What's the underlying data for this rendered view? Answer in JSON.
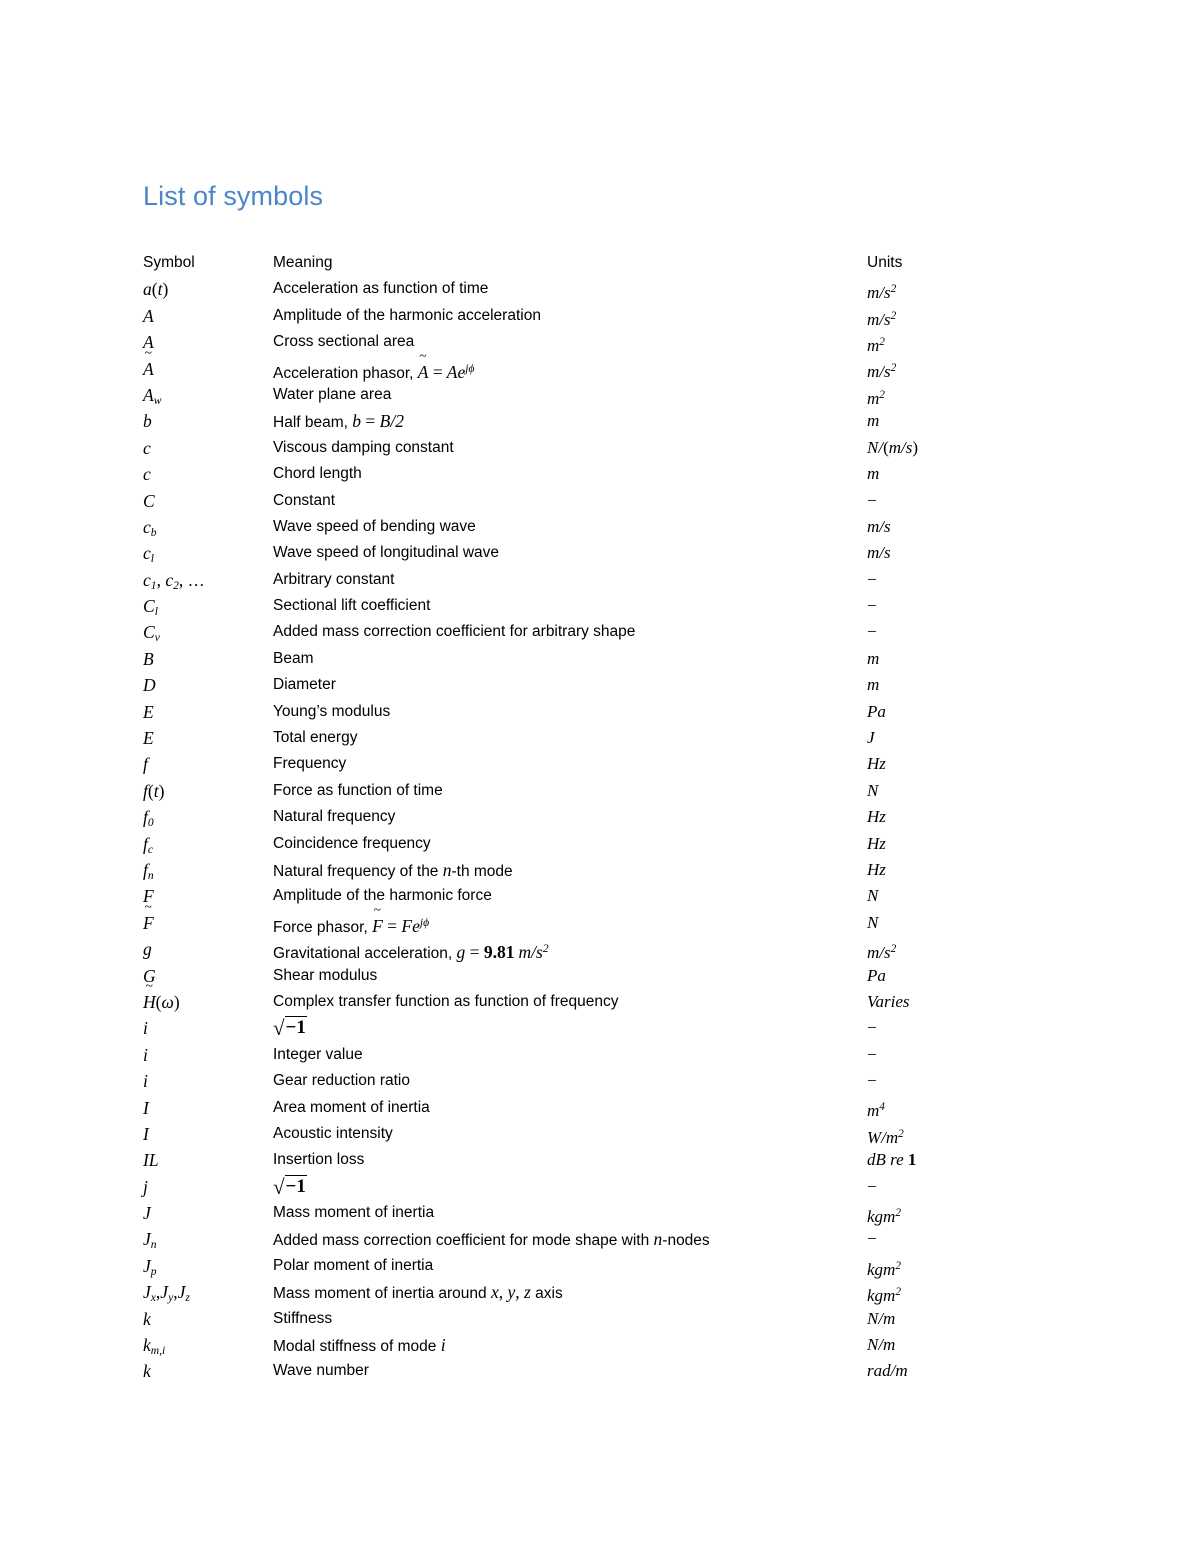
{
  "document": {
    "title": "List of symbols",
    "title_color": "#4a86c8"
  },
  "table": {
    "headers": {
      "symbol": "Symbol",
      "meaning": "Meaning",
      "units": "Units"
    },
    "rows": [
      {
        "symbol": "a(t)",
        "meaning": "Acceleration as function of time",
        "units": "m/s²"
      },
      {
        "symbol": "A",
        "meaning": "Amplitude of the harmonic acceleration",
        "units": "m/s²"
      },
      {
        "symbol": "A",
        "meaning": "Cross sectional area",
        "units": "m²"
      },
      {
        "symbol": "Ã",
        "meaning": "Acceleration phasor, Ã = Ae^{jφ}",
        "units": "m/s²"
      },
      {
        "symbol": "A_w",
        "meaning": "Water plane area",
        "units": "m²"
      },
      {
        "symbol": "b",
        "meaning": "Half beam, b = B/2",
        "units": "m"
      },
      {
        "symbol": "c",
        "meaning": "Viscous damping constant",
        "units": "N/(m/s)"
      },
      {
        "symbol": "c",
        "meaning": "Chord length",
        "units": "m"
      },
      {
        "symbol": "C",
        "meaning": "Constant",
        "units": "−"
      },
      {
        "symbol": "c_b",
        "meaning": "Wave speed of bending wave",
        "units": "m/s"
      },
      {
        "symbol": "c_l",
        "meaning": "Wave speed of longitudinal wave",
        "units": "m/s"
      },
      {
        "symbol": "c_1, c_2, …",
        "meaning": "Arbitrary constant",
        "units": "−"
      },
      {
        "symbol": "C_l",
        "meaning": "Sectional lift coefficient",
        "units": "−"
      },
      {
        "symbol": "C_v",
        "meaning": "Added mass correction coefficient for arbitrary shape",
        "units": "−"
      },
      {
        "symbol": "B",
        "meaning": "Beam",
        "units": "m"
      },
      {
        "symbol": "D",
        "meaning": "Diameter",
        "units": "m"
      },
      {
        "symbol": "E",
        "meaning": "Young’s modulus",
        "units": "Pa"
      },
      {
        "symbol": "E",
        "meaning": "Total energy",
        "units": "J"
      },
      {
        "symbol": "f",
        "meaning": "Frequency",
        "units": "Hz"
      },
      {
        "symbol": "f(t)",
        "meaning": "Force as function of time",
        "units": "N"
      },
      {
        "symbol": "f_0",
        "meaning": "Natural frequency",
        "units": "Hz"
      },
      {
        "symbol": "f_c",
        "meaning": "Coincidence frequency",
        "units": "Hz"
      },
      {
        "symbol": "f_n",
        "meaning": "Natural frequency of the n-th mode",
        "units": "Hz"
      },
      {
        "symbol": "F",
        "meaning": "Amplitude of the harmonic force",
        "units": "N"
      },
      {
        "symbol": "F̃",
        "meaning": "Force phasor, F̃ = Fe^{jφ}",
        "units": "N"
      },
      {
        "symbol": "g",
        "meaning": "Gravitational acceleration, g = 9.81 m/s²",
        "units": "m/s²"
      },
      {
        "symbol": "G",
        "meaning": "Shear modulus",
        "units": "Pa"
      },
      {
        "symbol": "H̃(ω)",
        "meaning": "Complex transfer function as function of frequency",
        "units": "Varies"
      },
      {
        "symbol": "i",
        "meaning": "√−1",
        "units": "−"
      },
      {
        "symbol": "i",
        "meaning": "Integer value",
        "units": "−"
      },
      {
        "symbol": "i",
        "meaning": "Gear reduction ratio",
        "units": "−"
      },
      {
        "symbol": "I",
        "meaning": "Area moment of inertia",
        "units": "m⁴"
      },
      {
        "symbol": "I",
        "meaning": "Acoustic intensity",
        "units": "W/m²"
      },
      {
        "symbol": "IL",
        "meaning": "Insertion loss",
        "units": "dB re 1"
      },
      {
        "symbol": "j",
        "meaning": "√−1",
        "units": "−"
      },
      {
        "symbol": "J",
        "meaning": "Mass moment of inertia",
        "units": "kgm²"
      },
      {
        "symbol": "J_n",
        "meaning": "Added mass correction coefficient for mode shape with n-nodes",
        "units": "−"
      },
      {
        "symbol": "J_p",
        "meaning": "Polar moment of inertia",
        "units": "kgm²"
      },
      {
        "symbol": "J_x, J_y, J_z",
        "meaning": "Mass moment of inertia around x, y, z axis",
        "units": "kgm²"
      },
      {
        "symbol": "k",
        "meaning": "Stiffness",
        "units": "N/m"
      },
      {
        "symbol": "k_m,i",
        "meaning": "Modal stiffness of mode i",
        "units": "N/m"
      },
      {
        "symbol": "k",
        "meaning": "Wave number",
        "units": "rad/m"
      }
    ]
  }
}
